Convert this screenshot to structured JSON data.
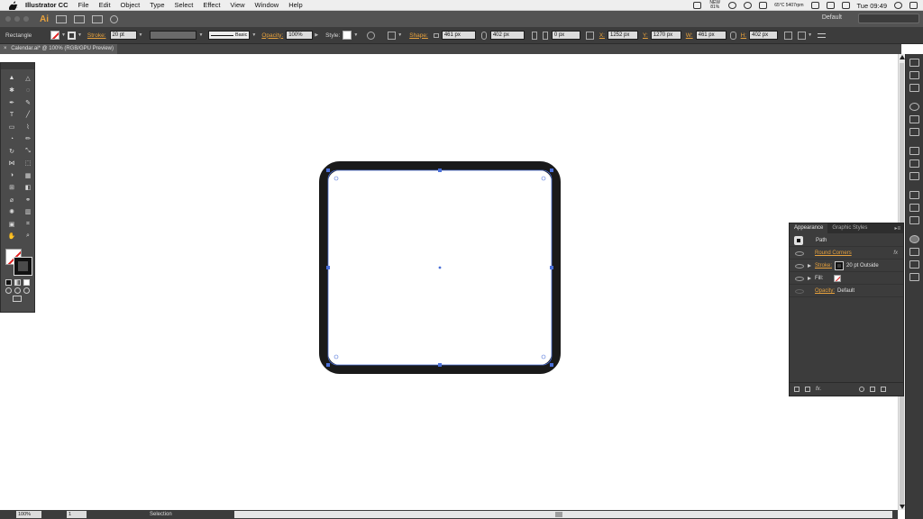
{
  "menubar": {
    "app_name": "Illustrator CC",
    "items": [
      "File",
      "Edit",
      "Object",
      "Type",
      "Select",
      "Effect",
      "View",
      "Window",
      "Help"
    ],
    "status": {
      "network": "NEW 81%",
      "temps": "65°C 5407rpm",
      "clock": "Tue 09:49"
    }
  },
  "appbar": {
    "logo": "Ai",
    "workspace": "Default"
  },
  "control_bar": {
    "selection_type": "Rectangle",
    "stroke_label": "Stroke:",
    "stroke_weight": "20 pt",
    "brush": "Basic",
    "opacity_label": "Opacity:",
    "opacity_value": "100%",
    "style_label": "Style:",
    "shape_label": "Shape:",
    "shape_w": "461 px",
    "shape_h": "402 px",
    "corner": "0 px",
    "x_label": "X:",
    "x_value": "1252 px",
    "y_label": "Y:",
    "y_value": "1270 px",
    "w_label": "W:",
    "w_value": "461 px",
    "h_label": "H:",
    "h_value": "402 px"
  },
  "document_tab": {
    "title": "Calendar.ai* @ 100% (RGB/GPU Preview)"
  },
  "tools": [
    "selection-tool",
    "direct-selection-tool",
    "magic-wand-tool",
    "lasso-tool",
    "pen-tool",
    "curvature-tool",
    "type-tool",
    "line-tool",
    "rectangle-tool",
    "paintbrush-tool",
    "shaper-tool",
    "pencil-tool",
    "rotate-tool",
    "scale-tool",
    "width-tool",
    "free-transform-tool",
    "shape-builder-tool",
    "perspective-grid-tool",
    "mesh-tool",
    "gradient-tool",
    "eyedropper-tool",
    "blend-tool",
    "symbol-sprayer-tool",
    "column-graph-tool",
    "artboard-tool",
    "slice-tool",
    "hand-tool",
    "zoom-tool"
  ],
  "appearance_panel": {
    "tabs": [
      "Appearance",
      "Graphic Styles"
    ],
    "object": "Path",
    "effect": "Round Corners",
    "fx": "fx",
    "stroke_label": "Stroke:",
    "stroke_value": "20 pt  Outside",
    "fill_label": "Fill:",
    "opacity_label": "Opacity:",
    "opacity_value": "Default",
    "footer_fx": "fx."
  },
  "statusbar": {
    "zoom": "100%",
    "page": "1",
    "tool": "Selection"
  },
  "colors": {
    "accent": "#e8a23d",
    "stroke": "#1a1a1a",
    "selection": "#4a6fd8",
    "panel": "#3c3c3c"
  }
}
